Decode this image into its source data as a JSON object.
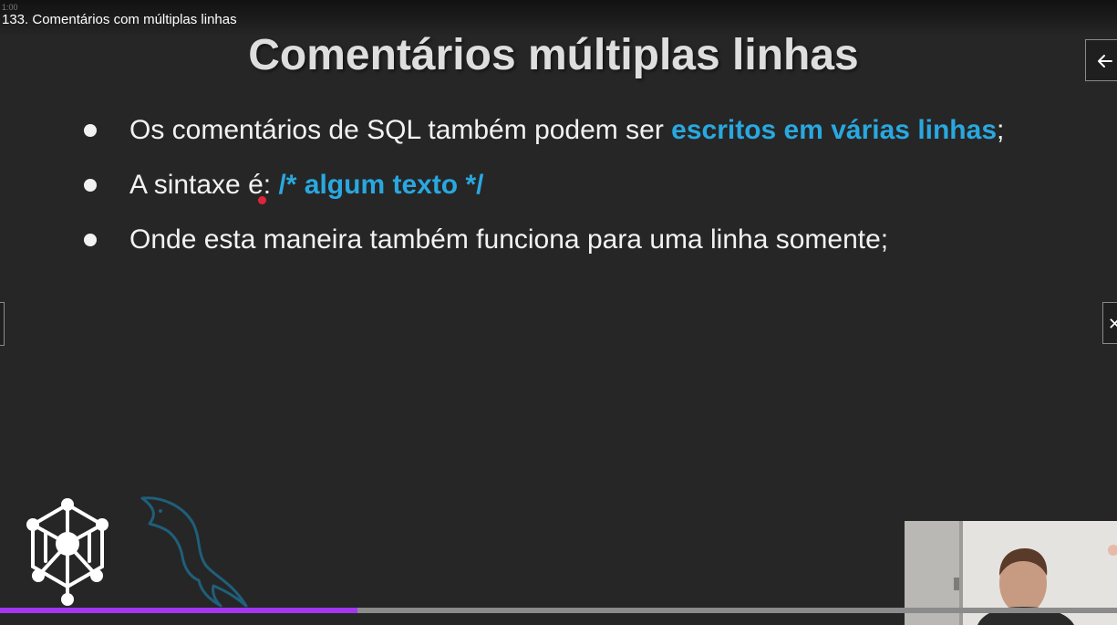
{
  "player": {
    "time_indicator": "1:00",
    "video_title": "133. Comentários com múltiplas linhas",
    "progress_fraction": 0.32
  },
  "slide": {
    "title": "Comentários múltiplas linhas",
    "bullets": [
      {
        "text_before": "Os comentários de SQL também podem ser ",
        "highlight": "escritos em várias linhas",
        "text_after": ";"
      },
      {
        "text_before": "A sintaxe é: ",
        "highlight": "/* algum texto */",
        "text_after": ""
      },
      {
        "text_before": "Onde esta maneira também funciona para uma linha somente;",
        "highlight": "",
        "text_after": ""
      }
    ]
  },
  "icons": {
    "back": "arrow-left-icon",
    "next": "close-icon",
    "logo_hex": "network-hexagon-logo",
    "logo_dolphin": "mysql-dolphin-logo"
  },
  "colors": {
    "background": "#262626",
    "highlight": "#29a8e0",
    "progress": "#a435f0",
    "cursor": "#e0243a"
  }
}
